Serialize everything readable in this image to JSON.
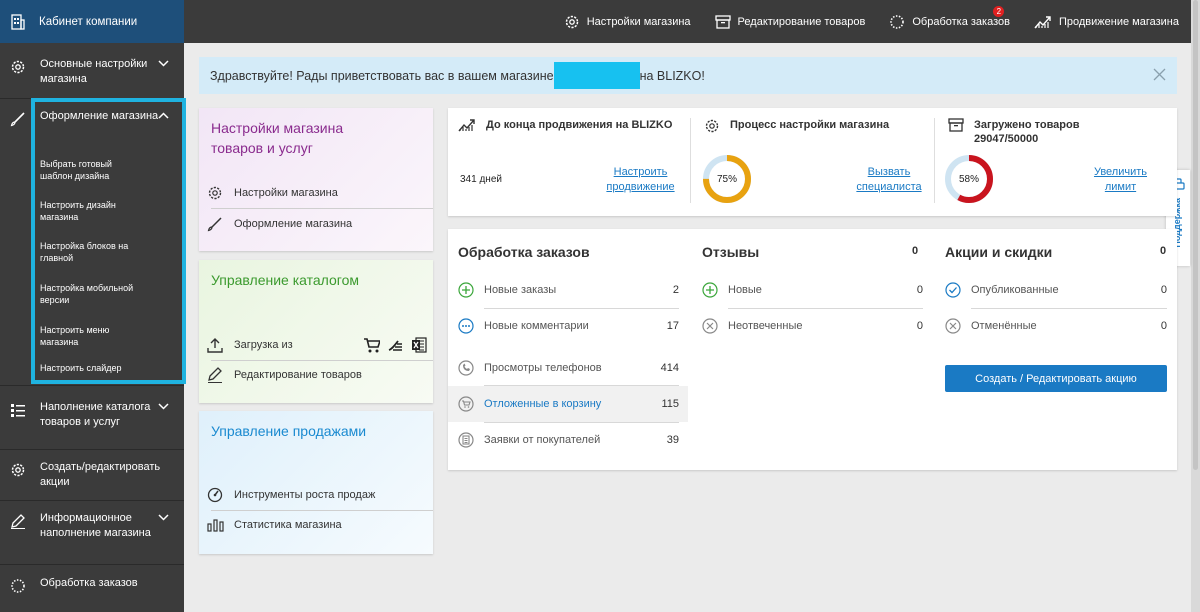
{
  "sidebar": {
    "brand": "Кабинет компании",
    "items": [
      {
        "label": "Основные настройки магазина"
      },
      {
        "label": "Оформление магазина"
      },
      {
        "label": "Наполнение каталога товаров и услуг"
      },
      {
        "label": "Создать/редактировать акции"
      },
      {
        "label": "Информационное наполнение магазина"
      },
      {
        "label": "Обработка заказов"
      }
    ],
    "subitems": [
      "Выбрать готовый шаблон дизайна",
      "Настроить дизайн магазина",
      "Настройка блоков на главной",
      "Настройка мобильной версии",
      "Настроить меню магазина",
      "Настроить слайдер"
    ]
  },
  "topbar": {
    "items": [
      {
        "label": "Настройки магазина",
        "icon": "gear-icon"
      },
      {
        "label": "Редактирование товаров",
        "icon": "archive-icon"
      },
      {
        "label": "Обработка заказов",
        "icon": "spinner-icon"
      },
      {
        "label": "Продвижение магазина",
        "icon": "trend-icon"
      }
    ],
    "orders_badge": "2"
  },
  "greeting": {
    "before": "Здравствуйте! Рады приветствовать вас в вашем магазине",
    "after": "на BLIZKO!"
  },
  "cards": [
    {
      "title": "Настройки магазина товаров и услуг",
      "links": [
        "Настройки магазина",
        "Оформление магазина"
      ]
    },
    {
      "title": "Управление каталогом",
      "links": [
        "Загрузка из",
        "Редактирование товаров"
      ]
    },
    {
      "title": "Управление продажами",
      "links": [
        "Инструменты роста продаж",
        "Статистика магазина"
      ]
    }
  ],
  "stats": {
    "promotion": {
      "title": "До конца продвижения на BLIZKO",
      "days": "341 дней",
      "link": "Настроить продвижение"
    },
    "setup": {
      "title": "Процесс настройки магазина",
      "percent_label": "75%",
      "percent": 75,
      "link": "Вызвать специалиста"
    },
    "uploaded": {
      "title": "Загружено товаров",
      "count": "29047/50000",
      "percent_label": "58%",
      "percent": 58,
      "link": "Увеличить лимит"
    }
  },
  "orders": {
    "title": "Обработка заказов",
    "rows": [
      {
        "label": "Новые заказы",
        "count": "2"
      },
      {
        "label": "Новые комментарии",
        "count": "17"
      },
      {
        "label": "Просмотры телефонов",
        "count": "414"
      },
      {
        "label": "Отложенные в корзину",
        "count": "115"
      },
      {
        "label": "Заявки от покупателей",
        "count": "39"
      }
    ]
  },
  "reviews": {
    "title": "Отзывы",
    "total": "0",
    "rows": [
      {
        "label": "Новые",
        "count": "0"
      },
      {
        "label": "Неотвеченные",
        "count": "0"
      }
    ]
  },
  "promos": {
    "title": "Акции и скидки",
    "total": "0",
    "rows": [
      {
        "label": "Опубликованные",
        "count": "0"
      },
      {
        "label": "Отменённые",
        "count": "0"
      }
    ],
    "button": "Создать / Редактировать акцию"
  },
  "support": "Поддержка",
  "colors": {
    "accent": "#1a7ac4",
    "highlight": "#1fb3e0",
    "sidebar": "#3b3b3b",
    "brand_bar": "#1e4f7a"
  }
}
